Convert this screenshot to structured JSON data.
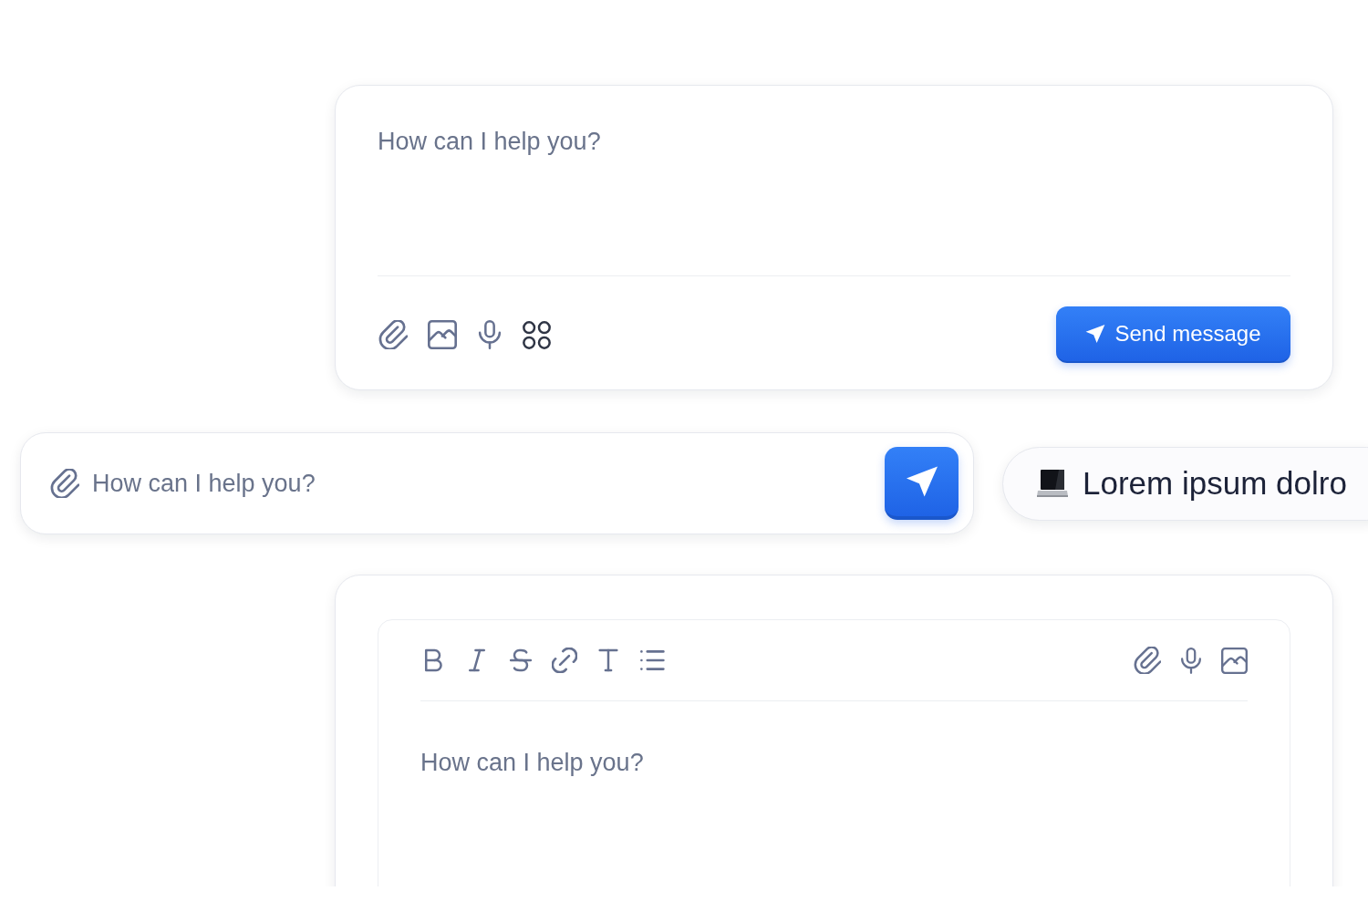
{
  "composer": {
    "placeholder": "How can I help you?",
    "send_button": {
      "label": "Send message"
    }
  },
  "compact_composer": {
    "placeholder": "How can I help you?"
  },
  "suggestion_chip": {
    "label": "Lorem ipsum dolro"
  },
  "rich_text_composer": {
    "placeholder": "How can I help you?"
  }
}
